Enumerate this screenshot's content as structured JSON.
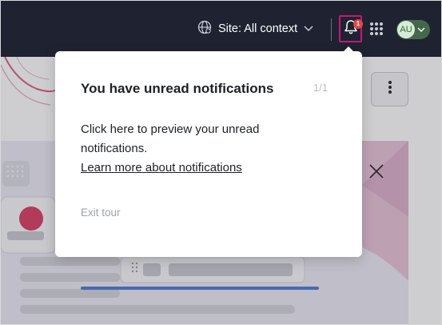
{
  "navbar": {
    "site_selector": {
      "label": "Site: All context"
    },
    "notifications": {
      "badge": "1"
    },
    "user": {
      "initials": "AU"
    }
  },
  "tour": {
    "title": "You have unread notifications",
    "step": "1/1",
    "body": "Click here to preview your unread notifications.",
    "link": "Learn more about notifications",
    "exit": "Exit tour"
  },
  "colors": {
    "navbar_bg": "#1f2231",
    "highlight": "#c4177a",
    "badge": "#e24646",
    "avatar_bg": "#d7ecd8"
  }
}
